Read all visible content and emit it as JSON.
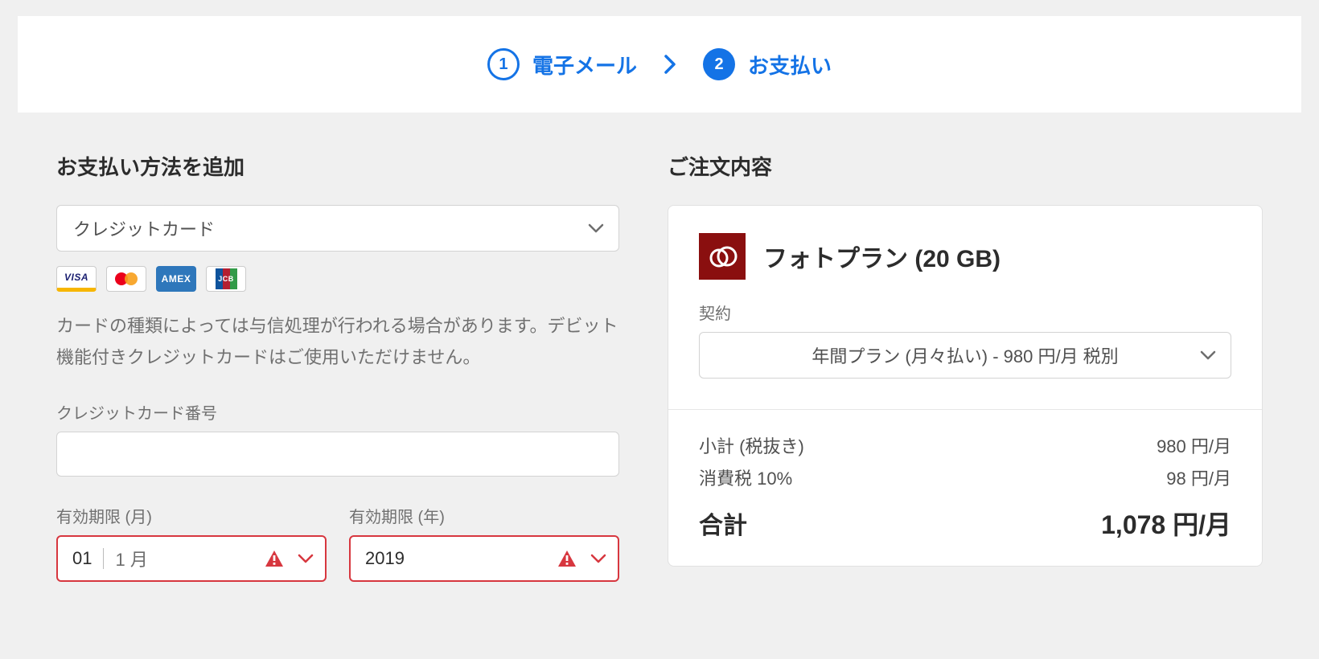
{
  "stepper": {
    "step1": {
      "num": "1",
      "label": "電子メール"
    },
    "step2": {
      "num": "2",
      "label": "お支払い"
    }
  },
  "payment": {
    "section_title": "お支払い方法を追加",
    "method_selected": "クレジットカード",
    "brands": [
      "VISA",
      "mastercard",
      "AMEX",
      "JCB"
    ],
    "hint": "カードの種類によっては与信処理が行われる場合があります。デビット機能付きクレジットカードはご使用いただけません。",
    "cc_label": "クレジットカード番号",
    "cc_value": "",
    "exp_month_label": "有効期限 (月)",
    "exp_month_code": "01",
    "exp_month_text": "1 月",
    "exp_year_label": "有効期限 (年)",
    "exp_year_value": "2019"
  },
  "order": {
    "section_title": "ご注文内容",
    "product_name": "フォトプラン (20 GB)",
    "contract_label": "契約",
    "plan_selected": "年間プラン (月々払い)  -  980 円/月  税別",
    "subtotal_label": "小計 (税抜き)",
    "subtotal_value": "980 円/月",
    "tax_label": "消費税 10%",
    "tax_value": "98 円/月",
    "total_label": "合計",
    "total_value": "1,078 円/月"
  }
}
